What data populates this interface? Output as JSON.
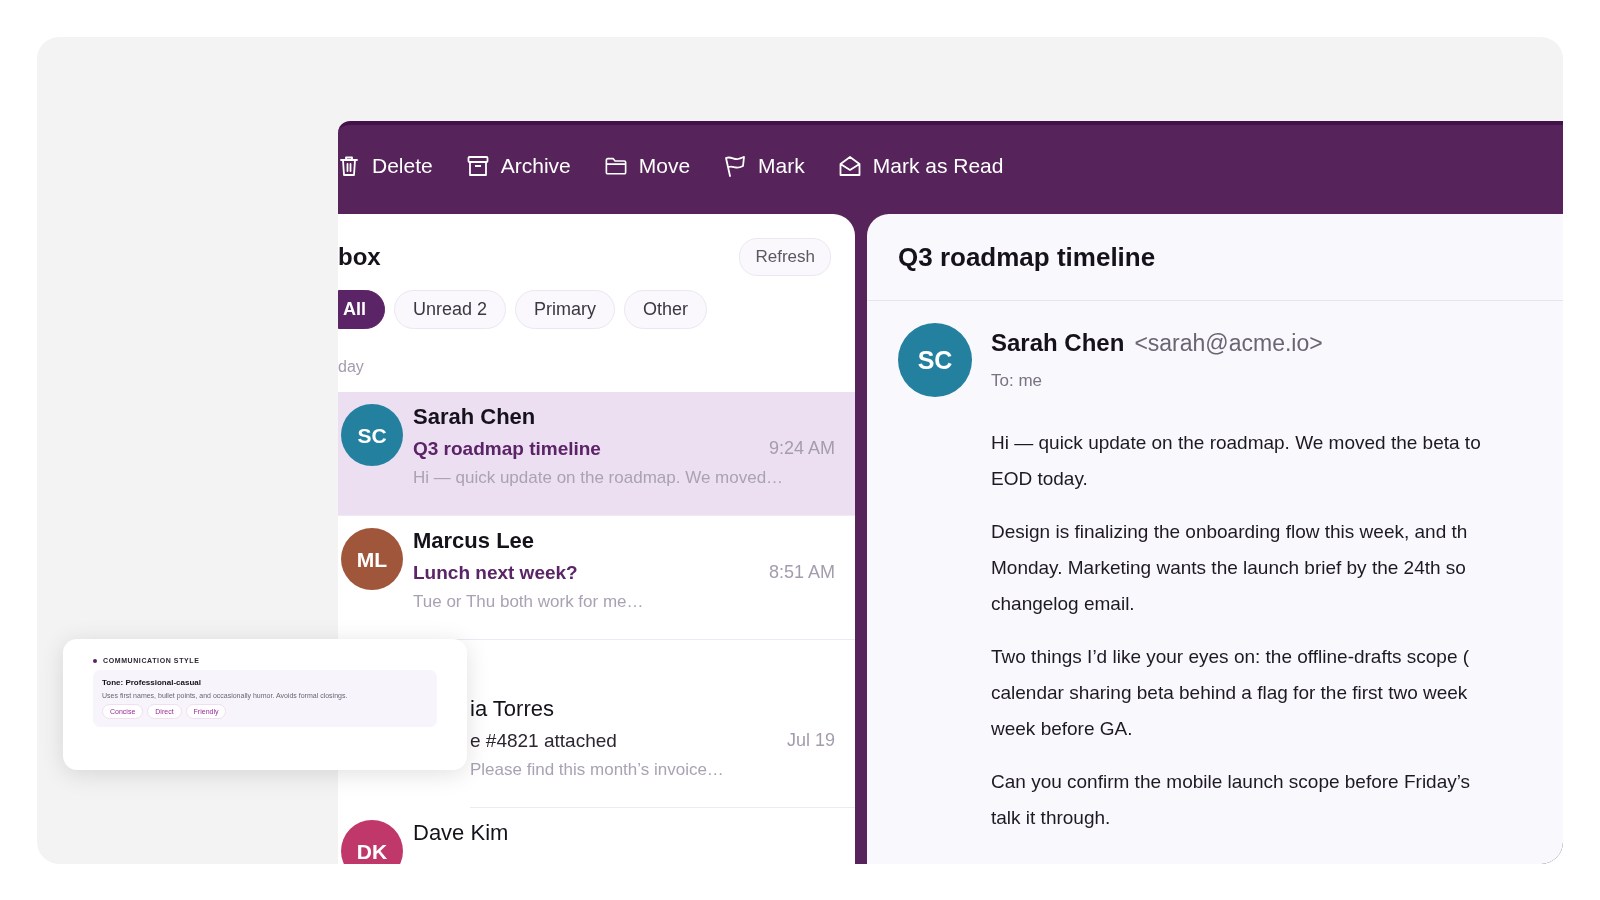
{
  "toolbar": {
    "actions": [
      {
        "kind": "trash",
        "label": "Delete"
      },
      {
        "kind": "archive",
        "label": "Archive"
      },
      {
        "kind": "folder",
        "label": "Move"
      },
      {
        "kind": "flag",
        "label": "Mark"
      },
      {
        "kind": "envelope",
        "label": "Mark as Read"
      }
    ]
  },
  "list": {
    "title": "box",
    "refresh": "Refresh",
    "filters": [
      {
        "label": "All",
        "selected": true
      },
      {
        "label": "Unread 2",
        "selected": false
      },
      {
        "label": "Primary",
        "selected": false
      },
      {
        "label": "Other",
        "selected": false
      }
    ],
    "groups": [
      {
        "label": "day",
        "items": [
          {
            "sender": "Sarah Chen",
            "initials": "SC",
            "color": "#23809f",
            "subject": "Q3 roadmap timeline",
            "time": "9:24 AM",
            "preview": "Hi — quick update on the roadmap. We moved…",
            "selected": true,
            "unread": true
          },
          {
            "sender": "Marcus Lee",
            "initials": "ML",
            "color": "#a0563a",
            "subject": "Lunch next week?",
            "time": "8:51 AM",
            "preview": "Tue or Thu both work for me…",
            "selected": false,
            "unread": true
          }
        ]
      },
      {
        "items": [
          {
            "sender": "ia Torres",
            "subject": "e #4821 attached",
            "time": "Jul 19",
            "preview": "Please find this month’s invoice…",
            "selected": false,
            "unread": false
          },
          {
            "sender": "Dave Kim",
            "initials": "DK",
            "color": "#c0386a",
            "selected": false,
            "unread": false
          }
        ]
      }
    ]
  },
  "message": {
    "subject": "Q3 roadmap timeline",
    "sender": "Sarah Chen",
    "initials": "SC",
    "color": "#23809f",
    "email": "<sarah@acme.io>",
    "to": "To: me",
    "paragraphs": [
      [
        "Hi — quick update on the roadmap. We moved the beta to",
        "EOD today."
      ],
      [
        "Design is finalizing the onboarding flow this week, and th",
        "Monday. Marketing wants the launch brief by the 24th so",
        "changelog email."
      ],
      [
        "Two things I’d like your eyes on: the offline-drafts scope (",
        "calendar sharing beta behind a flag for the first two week",
        "week before GA."
      ],
      [
        "Can you confirm the mobile launch scope before Friday’s",
        "talk it through."
      ]
    ]
  },
  "style_card": {
    "label": "COMMUNICATION STYLE",
    "tone": "Tone: Professional-casual",
    "description": "Uses first names, bullet points, and occasionally humor. Avoids formal closings.",
    "tags": [
      "Concise",
      "Direct",
      "Friendly"
    ]
  }
}
